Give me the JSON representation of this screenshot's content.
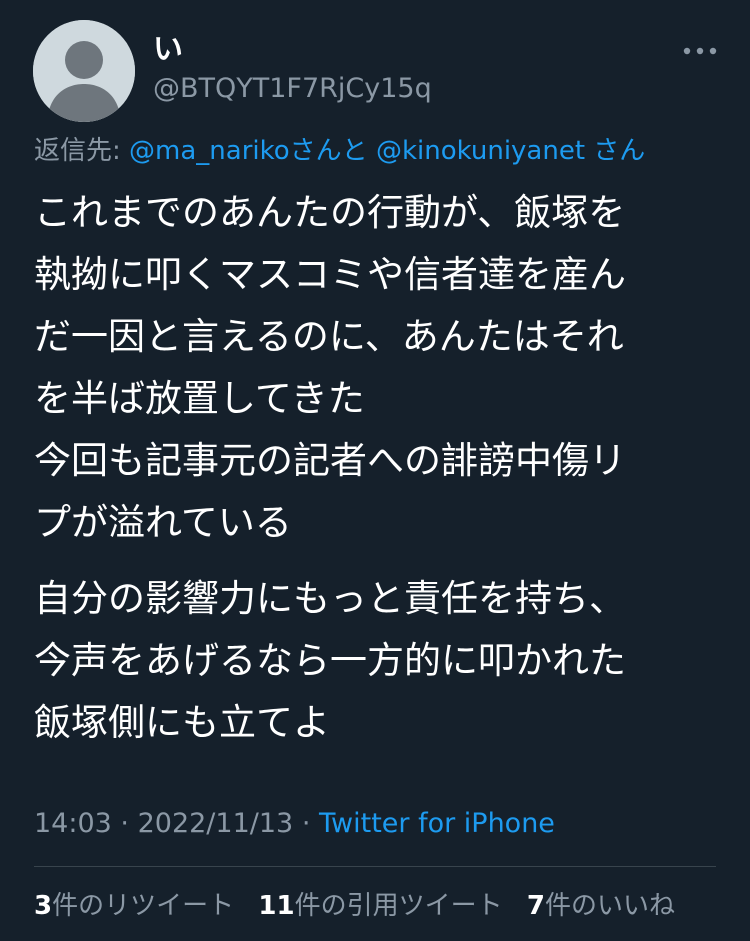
{
  "author": {
    "display_name": "い",
    "handle": "@BTQYT1F7RjCy15q",
    "avatar_icon": "default-profile-icon"
  },
  "more_icon": "more-horizontal-icon",
  "reply": {
    "prefix": "返信先:",
    "mention1": "@ma_nariko",
    "connector": "さんと",
    "mention2": "@kinokuniyanet",
    "suffix": "さん"
  },
  "tweet": {
    "lines": [
      "これまでのあんたの行動が、飯塚を",
      "執拗に叩くマスコミや信者達を産ん",
      "だ一因と言えるのに、あんたはそれ",
      "を半ば放置してきた",
      "今回も記事元の記者への誹謗中傷リ",
      "プが溢れている",
      "自分の影響力にもっと責任を持ち、",
      "今声をあげるなら一方的に叩かれた",
      "飯塚側にも立てよ"
    ]
  },
  "meta": {
    "time": "14:03",
    "separator": "·",
    "date": "2022/11/13",
    "source": "Twitter for iPhone"
  },
  "stats": {
    "retweets_count": "3",
    "retweets_label": "件のリツイート",
    "quotes_count": "11",
    "quotes_label": "件の引用ツイート",
    "likes_count": "7",
    "likes_label": "件のいいね"
  },
  "colors": {
    "background": "#15202b",
    "accent": "#1d9bf0",
    "secondary_text": "#8b98a5",
    "divider": "#38444d"
  }
}
